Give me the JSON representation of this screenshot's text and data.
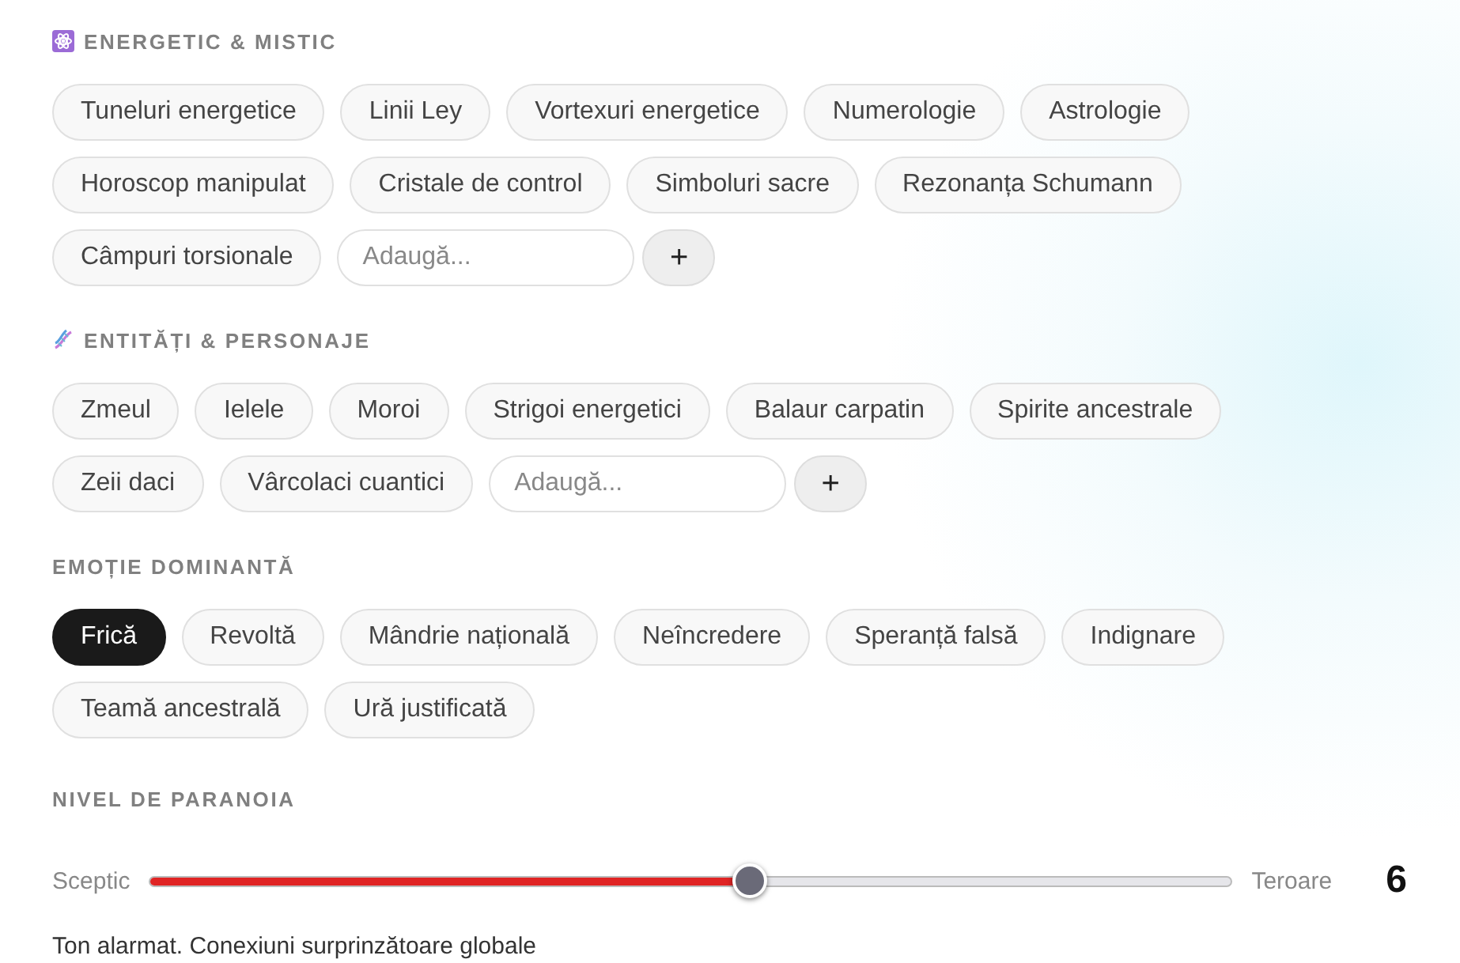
{
  "sections": [
    {
      "kind": "tags",
      "title": "ENERGETIC & MISTIC",
      "tags": [
        "Tuneluri energetice",
        "Linii Ley",
        "Vortexuri energetice",
        "Numerologie",
        "Astrologie",
        "Horoscop manipulat",
        "Cristale de control",
        "Simboluri sacre",
        "Rezonanța Schumann",
        "Câmpuri torsionale"
      ],
      "add": {
        "placeholder": "Adaugă...",
        "button": "+"
      }
    },
    {
      "kind": "tags",
      "title": "ENTITĂȚI & PERSONAJE",
      "tags": [
        "Zmeul",
        "Ielele",
        "Moroi",
        "Strigoi energetici",
        "Balaur carpatin",
        "Spirite ancestrale",
        "Zeii daci",
        "Vârcolaci cuantici"
      ],
      "add": {
        "placeholder": "Adaugă...",
        "button": "+"
      }
    },
    {
      "kind": "choice",
      "title": "EMOȚIE DOMINANTĂ",
      "options": [
        {
          "label": "Frică",
          "selected": true
        },
        {
          "label": "Revoltă",
          "selected": false
        },
        {
          "label": "Mândrie națională",
          "selected": false
        },
        {
          "label": "Neîncredere",
          "selected": false
        },
        {
          "label": "Speranță falsă",
          "selected": false
        },
        {
          "label": "Indignare",
          "selected": false
        },
        {
          "label": "Teamă ancestrală",
          "selected": false
        },
        {
          "label": "Ură justificată",
          "selected": false
        }
      ]
    },
    {
      "kind": "slider",
      "title": "NIVEL DE PARANOIA",
      "min_label": "Sceptic",
      "max_label": "Teroare",
      "level": 0.555,
      "value": "6",
      "caption": "Ton alarmat. Conexiuni surprinzătoare globale"
    }
  ]
}
